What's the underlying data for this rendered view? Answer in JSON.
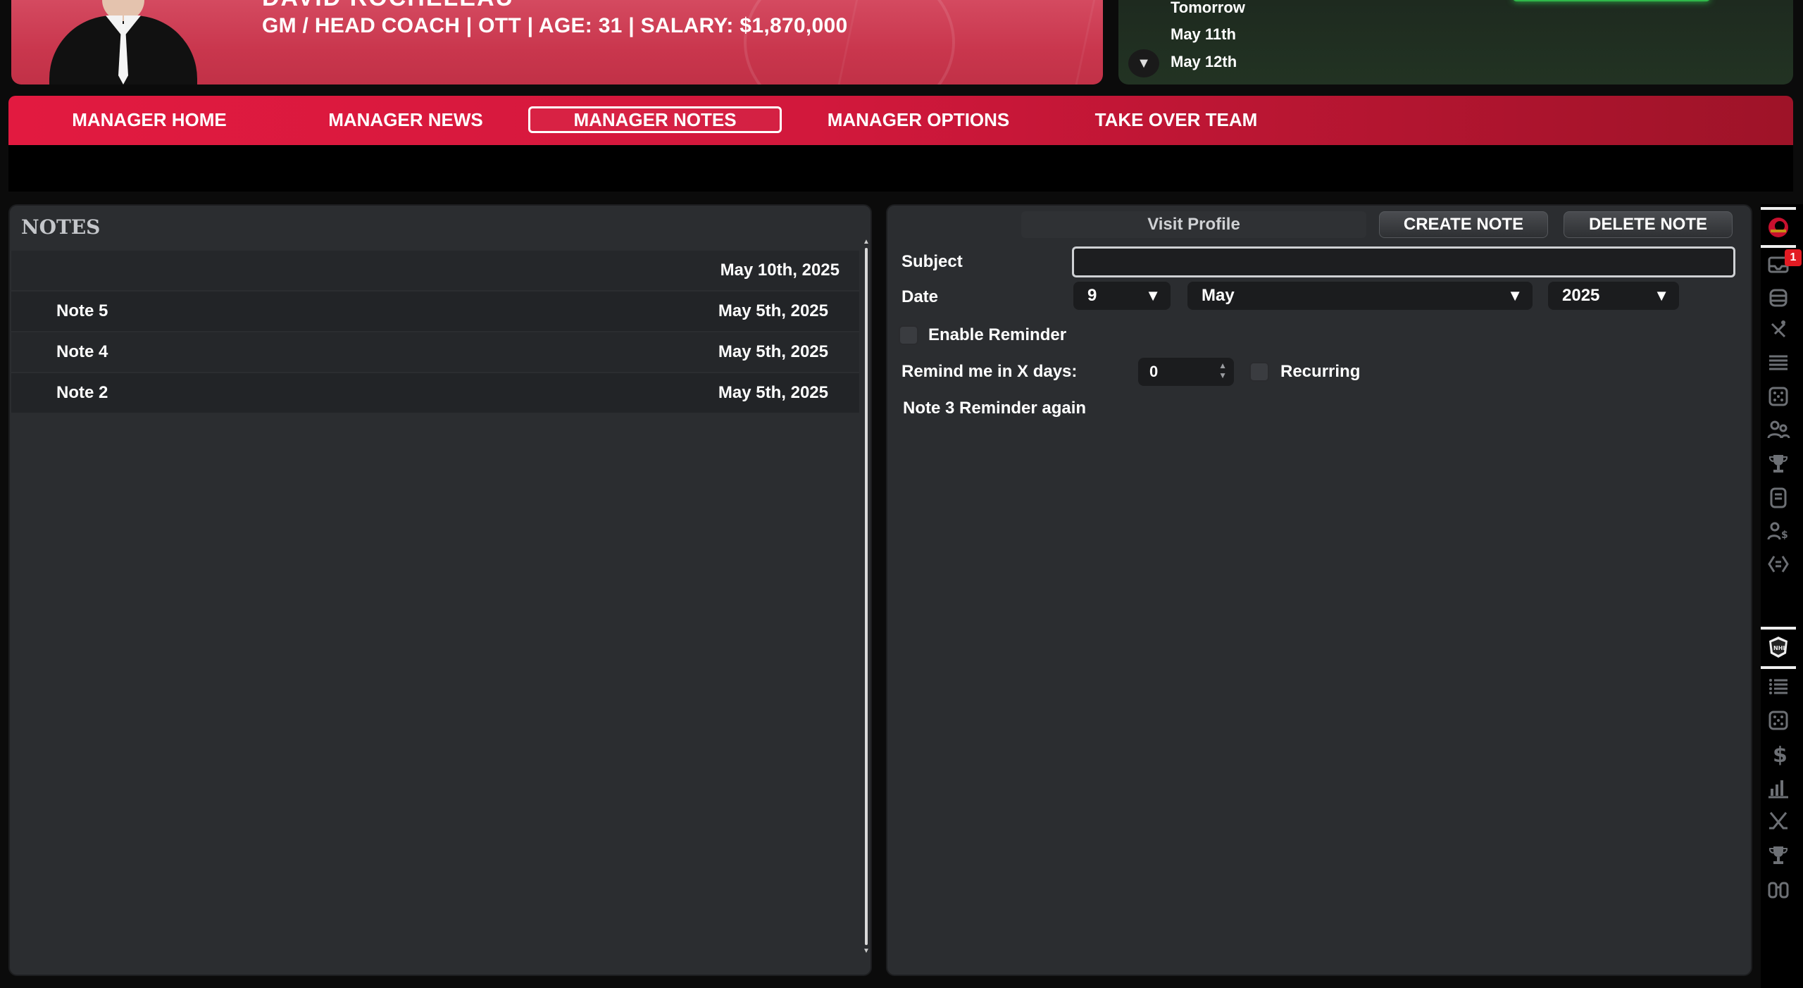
{
  "header": {
    "name_partial": "DAVID ROCHELEAU",
    "info": "GM / HEAD COACH | OTT | AGE: 31 | SALARY: $1,870,000"
  },
  "calendar": {
    "items": [
      "Tomorrow",
      "May 11th",
      "May 12th"
    ]
  },
  "nav": {
    "items": [
      "MANAGER HOME",
      "MANAGER NEWS",
      "MANAGER NOTES",
      "MANAGER OPTIONS",
      "TAKE OVER TEAM"
    ],
    "active": "MANAGER NOTES"
  },
  "notes": {
    "title": "NOTES",
    "rows": [
      {
        "title": "",
        "date": "May 10th, 2025"
      },
      {
        "title": "Note 5",
        "date": "May 5th, 2025"
      },
      {
        "title": "Note 4",
        "date": "May 5th, 2025"
      },
      {
        "title": "Note 2",
        "date": "May 5th, 2025"
      }
    ]
  },
  "editor": {
    "visit_profile": "Visit Profile",
    "create_note": "CREATE NOTE",
    "delete_note": "DELETE NOTE",
    "subject_label": "Subject",
    "subject_value": "",
    "date_label": "Date",
    "day": "9",
    "month": "May",
    "year": "2025",
    "enable_reminder": "Enable Reminder",
    "remind_label": "Remind me in X days:",
    "remind_days": "0",
    "recurring": "Recurring",
    "body": "Note 3 Reminder again"
  },
  "sidebar": {
    "badge": "1",
    "team_icons": [
      "team-logo-icon",
      "inbox-icon",
      "database-icon",
      "player-swap-icon",
      "list-icon",
      "dice-icon",
      "people-icon",
      "trophy-icon",
      "document-icon",
      "person-dollar-icon",
      "code-icon"
    ],
    "league_icons": [
      "league-logo-icon",
      "list-icon",
      "dice-icon",
      "dollar-icon",
      "bar-chart-icon",
      "sticks-icon",
      "trophy-icon",
      "binoculars-icon"
    ]
  }
}
